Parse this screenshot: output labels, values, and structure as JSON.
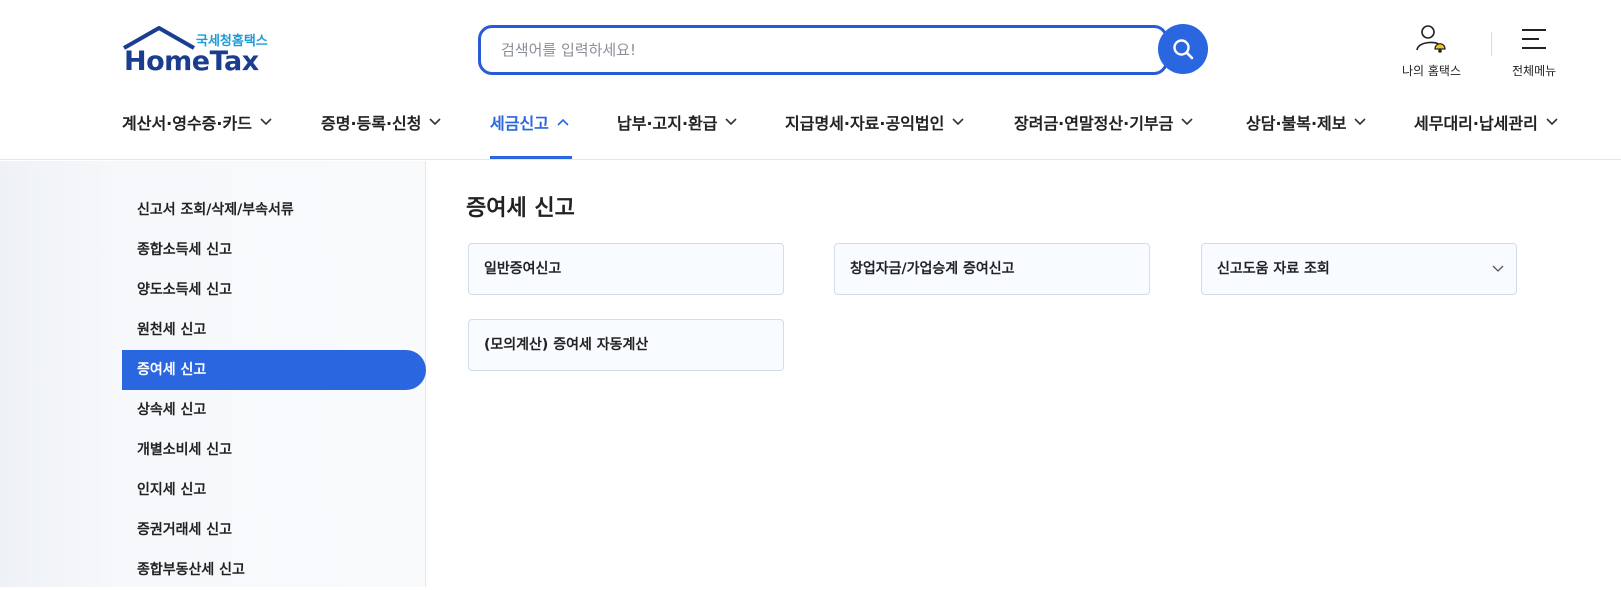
{
  "brand": {
    "sub": "국세청홈택스",
    "main": "HomeTax",
    "color": "#1a3d8f",
    "sub_color": "#1f9bd7"
  },
  "search": {
    "placeholder": "검색어를 입력하세요!",
    "value": "",
    "icon": "search-icon"
  },
  "utilities": [
    {
      "label": "나의 홈택스",
      "icon": "user-bell-icon"
    },
    {
      "label": "전체메뉴",
      "icon": "hamburger-menu-icon"
    }
  ],
  "nav": [
    {
      "label": "계산서·영수증·카드",
      "active": false
    },
    {
      "label": "증명·등록·신청",
      "active": false
    },
    {
      "label": "세금신고",
      "active": true
    },
    {
      "label": "납부·고지·환급",
      "active": false
    },
    {
      "label": "지급명세·자료·공익법인",
      "active": false
    },
    {
      "label": "장려금·연말정산·기부금",
      "active": false
    },
    {
      "label": "상담·불복·제보",
      "active": false
    },
    {
      "label": "세무대리·납세관리",
      "active": false
    }
  ],
  "sidebar": {
    "items": [
      {
        "label": "신고서 조회/삭제/부속서류"
      },
      {
        "label": "종합소득세 신고"
      },
      {
        "label": "양도소득세 신고"
      },
      {
        "label": "원천세 신고"
      },
      {
        "label": "증여세 신고",
        "active": true
      },
      {
        "label": "상속세 신고"
      },
      {
        "label": "개별소비세 신고"
      },
      {
        "label": "인지세 신고"
      },
      {
        "label": "증권거래세 신고"
      },
      {
        "label": "종합부동산세 신고"
      }
    ]
  },
  "main": {
    "title": "증여세 신고",
    "cards": [
      {
        "label": "일반증여신고"
      },
      {
        "label": "창업자금/가업승계 증여신고"
      },
      {
        "label": "신고도움 자료 조회",
        "dropdown": true
      },
      {
        "label": "(모의계산) 증여세 자동계산"
      }
    ]
  },
  "colors": {
    "accent": "#2a66e0",
    "border": "#d3dcea"
  }
}
